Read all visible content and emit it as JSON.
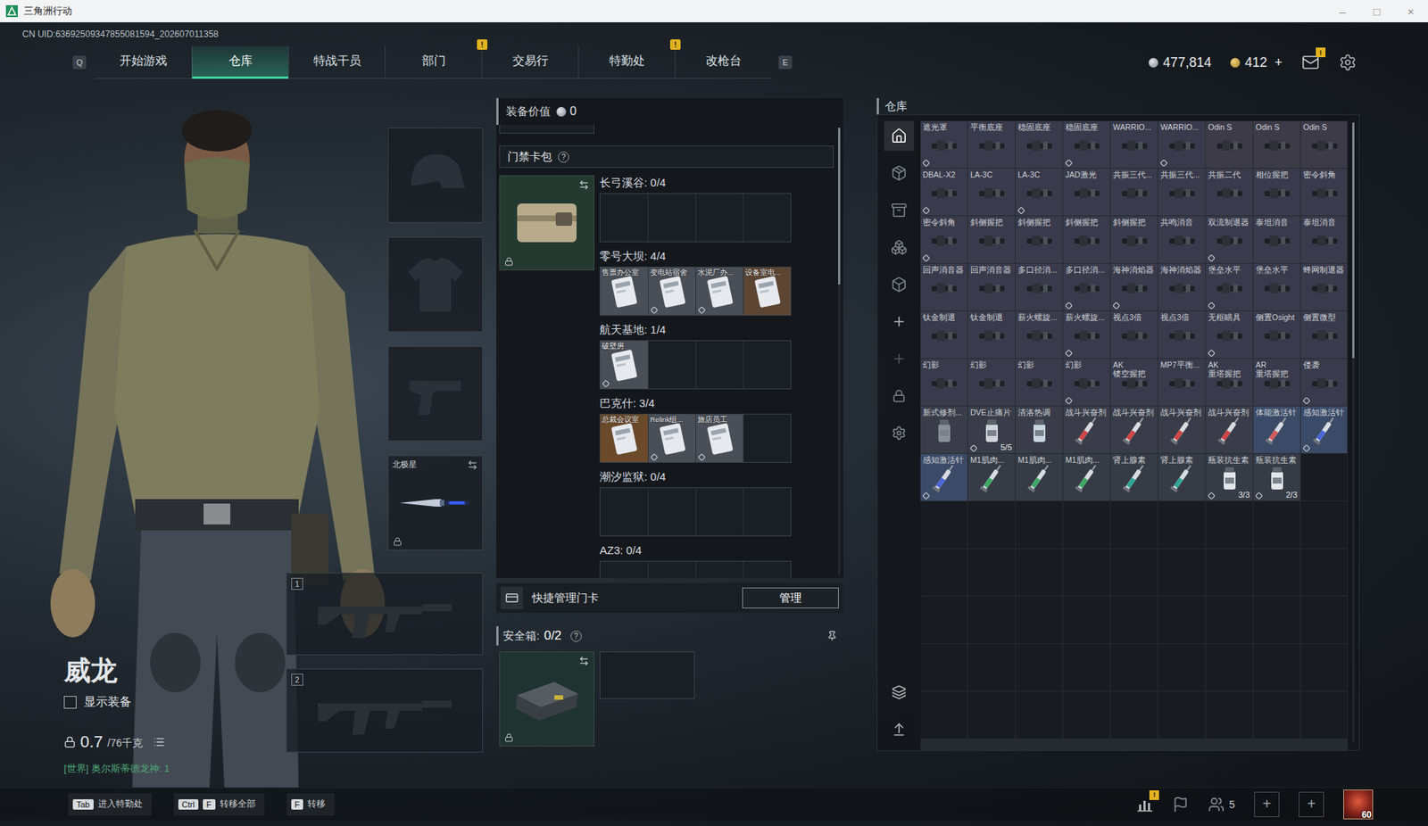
{
  "window": {
    "title": "三角洲行动",
    "controls": [
      "–",
      "□",
      "×"
    ]
  },
  "uid": "CN UID:63692509347855081594_202607011358",
  "nav": {
    "prev_key": "Q",
    "next_key": "E",
    "tabs": [
      {
        "label": "开始游戏",
        "selected": false
      },
      {
        "label": "仓库",
        "selected": true
      },
      {
        "label": "特战干员",
        "selected": false
      },
      {
        "label": "部门",
        "selected": false,
        "badge": "!"
      },
      {
        "label": "交易行",
        "selected": false
      },
      {
        "label": "特勤处",
        "selected": false,
        "badge": "!"
      },
      {
        "label": "改枪台",
        "selected": false
      }
    ]
  },
  "currency": [
    {
      "value": "477,814",
      "kind": "silver"
    },
    {
      "value": "412",
      "kind": "gold",
      "add": "+"
    }
  ],
  "mail_badge": "!",
  "character": {
    "name": "威龙",
    "show_equipment": {
      "label": "显示装备",
      "checked": false
    },
    "weight": {
      "value": "0.7",
      "capacity": "/76千克"
    },
    "world_chat": "[世界] 奥尔斯蒂德龙神: 1"
  },
  "equipment": {
    "slots": [
      {
        "kind": "helmet"
      },
      {
        "kind": "armor"
      },
      {
        "kind": "pistol"
      },
      {
        "kind": "knife",
        "label": "北极星",
        "locked": true
      }
    ],
    "weapons": [
      {
        "number": "1"
      },
      {
        "number": "2"
      }
    ]
  },
  "loadout": {
    "value_label": "装备价值",
    "value": "0",
    "keycard_pack": {
      "title": "门禁卡包",
      "help": "?",
      "locked": true,
      "scrollbar": {
        "offset": 0.0,
        "size": 0.35
      },
      "maps": [
        {
          "label": "长弓溪谷: 0/4",
          "slots": 4,
          "cards": []
        },
        {
          "label": "零号大坝: 4/4",
          "slots": 4,
          "cards": [
            {
              "label": "售票办公室",
              "color": "#4a4e57",
              "marked": false
            },
            {
              "label": "变电站宿舍",
              "color": "#4a4e57",
              "marked": true
            },
            {
              "label": "水泥厂办...",
              "color": "#4a4e57",
              "marked": true
            },
            {
              "label": "设备室电...",
              "color": "#5c4633",
              "marked": false
            }
          ]
        },
        {
          "label": "航天基地: 1/4",
          "slots": 4,
          "cards": [
            {
              "label": "破壁房",
              "color": "#4a4e57",
              "marked": true
            }
          ]
        },
        {
          "label": "巴克什: 3/4",
          "slots": 4,
          "cards": [
            {
              "label": "总裁会议室",
              "color": "#6b4a2a",
              "marked": false
            },
            {
              "label": "Relink组...",
              "color": "#4a4e57",
              "marked": true
            },
            {
              "label": "旅店员工",
              "color": "#4a4e57",
              "marked": true
            }
          ]
        },
        {
          "label": "潮汐监狱: 0/4",
          "slots": 4,
          "cards": []
        },
        {
          "label": "AZ3: 0/4",
          "slots": 4,
          "cards": []
        }
      ]
    },
    "quick_manage": {
      "label": "快捷管理门卡",
      "button": "管理"
    },
    "safebox": {
      "label": "安全箱:",
      "count": "0/2",
      "help": "?",
      "locked": true
    }
  },
  "warehouse": {
    "title": "仓库",
    "rail": [
      {
        "selected": true
      },
      {
        "selected": false
      },
      {
        "selected": false
      },
      {
        "selected": false
      },
      {
        "selected": false
      }
    ],
    "scrollbar": {
      "offset": 0.0,
      "size": 0.38
    },
    "rows": 13,
    "columns": 9,
    "items": [
      {
        "label": "遮光罩",
        "kind": "attachment",
        "color": "#393a4b",
        "marked": true
      },
      {
        "label": "平衡底座",
        "kind": "attachment",
        "color": "#393a4b",
        "marked": false
      },
      {
        "label": "稳固底座",
        "kind": "attachment",
        "color": "#393a4b",
        "marked": false
      },
      {
        "label": "稳固底座",
        "kind": "attachment",
        "color": "#393a4b",
        "marked": true
      },
      {
        "label": "WARRIO...",
        "kind": "attachment",
        "color": "#393a4b",
        "marked": false
      },
      {
        "label": "WARRIO...",
        "kind": "attachment",
        "color": "#393a4b",
        "marked": true
      },
      {
        "label": "Odin S",
        "kind": "attachment",
        "color": "#3d3b48",
        "marked": false
      },
      {
        "label": "Odin S",
        "kind": "attachment",
        "color": "#3d3b48",
        "marked": false
      },
      {
        "label": "Odin S",
        "kind": "attachment",
        "color": "#3d3b48",
        "marked": false
      },
      {
        "label": "DBAL-X2",
        "kind": "attachment",
        "color": "#393a4b",
        "marked": true
      },
      {
        "label": "LA-3C",
        "kind": "attachment",
        "color": "#393a4b",
        "marked": false
      },
      {
        "label": "LA-3C",
        "kind": "attachment",
        "color": "#393a4b",
        "marked": true
      },
      {
        "label": "JAD激光",
        "kind": "attachment",
        "color": "#393a4b",
        "marked": false
      },
      {
        "label": "共振三代...",
        "kind": "attachment",
        "color": "#393a4b",
        "marked": false
      },
      {
        "label": "共振三代...",
        "kind": "attachment",
        "color": "#393a4b",
        "marked": false
      },
      {
        "label": "共振二代",
        "kind": "attachment",
        "color": "#393a4b",
        "marked": false
      },
      {
        "label": "相位握把",
        "kind": "attachment",
        "color": "#393a4b",
        "marked": false
      },
      {
        "label": "密令斜角",
        "kind": "attachment",
        "color": "#393a4b",
        "marked": false
      },
      {
        "label": "密令斜角",
        "kind": "attachment",
        "color": "#393a4b",
        "marked": true
      },
      {
        "label": "斜侧握把",
        "kind": "attachment",
        "color": "#393a4b",
        "marked": false
      },
      {
        "label": "斜侧握把",
        "kind": "attachment",
        "color": "#393a4b",
        "marked": false
      },
      {
        "label": "斜侧握把",
        "kind": "attachment",
        "color": "#393a4b",
        "marked": false
      },
      {
        "label": "斜侧握把",
        "kind": "attachment",
        "color": "#393a4b",
        "marked": false
      },
      {
        "label": "共鸣消音",
        "kind": "attachment",
        "color": "#393a4b",
        "marked": false
      },
      {
        "label": "双流制退器",
        "kind": "attachment",
        "color": "#393a4b",
        "marked": true
      },
      {
        "label": "泰坦消音",
        "kind": "attachment",
        "color": "#393a4b",
        "marked": false
      },
      {
        "label": "泰坦消音",
        "kind": "attachment",
        "color": "#393a4b",
        "marked": false
      },
      {
        "label": "回声消音器",
        "kind": "attachment",
        "color": "#393a4b",
        "marked": false
      },
      {
        "label": "回声消音器",
        "kind": "attachment",
        "color": "#393a4b",
        "marked": false
      },
      {
        "label": "多口径消...",
        "kind": "attachment",
        "color": "#393a4b",
        "marked": false
      },
      {
        "label": "多口径消...",
        "kind": "attachment",
        "color": "#393a4b",
        "marked": true
      },
      {
        "label": "海神消焰器",
        "kind": "attachment",
        "color": "#393a4b",
        "marked": true
      },
      {
        "label": "海神消焰器",
        "kind": "attachment",
        "color": "#393a4b",
        "marked": false
      },
      {
        "label": "堡垒水平",
        "kind": "attachment",
        "color": "#393a4b",
        "marked": true
      },
      {
        "label": "堡垒水平",
        "kind": "attachment",
        "color": "#393a4b",
        "marked": false
      },
      {
        "label": "蜂网制退器",
        "kind": "attachment",
        "color": "#393a4b",
        "marked": false
      },
      {
        "label": "钛金制退",
        "kind": "attachment",
        "color": "#393a4b",
        "marked": false
      },
      {
        "label": "钛金制退",
        "kind": "attachment",
        "color": "#393a4b",
        "marked": false
      },
      {
        "label": "薪火螺旋...",
        "kind": "attachment",
        "color": "#393a4b",
        "marked": false
      },
      {
        "label": "薪火螺旋...",
        "kind": "attachment",
        "color": "#393a4b",
        "marked": true
      },
      {
        "label": "视点3倍",
        "kind": "attachment",
        "color": "#393a4b",
        "marked": false
      },
      {
        "label": "视点3倍",
        "kind": "attachment",
        "color": "#393a4b",
        "marked": false
      },
      {
        "label": "无框瞄具",
        "kind": "attachment",
        "color": "#393a4b",
        "marked": true
      },
      {
        "label": "侧置Osight",
        "kind": "attachment",
        "color": "#393a4b",
        "marked": false
      },
      {
        "label": "侧置微型",
        "kind": "attachment",
        "color": "#393a4b",
        "marked": false
      },
      {
        "label": "幻影",
        "kind": "attachment",
        "color": "#393a4b",
        "marked": false
      },
      {
        "label": "幻影",
        "kind": "attachment",
        "color": "#393a4b",
        "marked": false
      },
      {
        "label": "幻影",
        "kind": "attachment",
        "color": "#393a4b",
        "marked": false
      },
      {
        "label": "幻影",
        "kind": "attachment",
        "color": "#393a4b",
        "marked": true
      },
      {
        "label": "AK\n镂空握把",
        "kind": "attachment",
        "color": "#393a4b",
        "marked": false
      },
      {
        "label": "MP7平衡...",
        "kind": "attachment",
        "color": "#393a4b",
        "marked": false
      },
      {
        "label": "AK\n重塔握把",
        "kind": "attachment",
        "color": "#393a4b",
        "marked": false
      },
      {
        "label": "AR\n重塔握把",
        "kind": "attachment",
        "color": "#393a4b",
        "marked": false
      },
      {
        "label": "侵袭",
        "kind": "attachment",
        "color": "#393a4b",
        "marked": true
      },
      {
        "label": "新式修剂...",
        "kind": "bottle",
        "color": "#3a3d49",
        "marked": false,
        "accent": "#8a8f99"
      },
      {
        "label": "DVE止痛片",
        "kind": "bottle",
        "color": "#3a3d49",
        "marked": true,
        "count": "5/5",
        "accent": "#d0d4da"
      },
      {
        "label": "清洛热调",
        "kind": "bottle",
        "color": "#3a3d49",
        "marked": false,
        "accent": "#c9d6e0"
      },
      {
        "label": "战斗兴奋剂",
        "kind": "syringe",
        "color": "#3a3d49",
        "marked": false,
        "accent": "#d04545"
      },
      {
        "label": "战斗兴奋剂",
        "kind": "syringe",
        "color": "#3a3d49",
        "marked": false,
        "accent": "#d04545"
      },
      {
        "label": "战斗兴奋剂",
        "kind": "syringe",
        "color": "#3a3d49",
        "marked": false,
        "accent": "#d04545"
      },
      {
        "label": "战斗兴奋剂",
        "kind": "syringe",
        "color": "#3a3d49",
        "marked": false,
        "accent": "#d04545"
      },
      {
        "label": "体能激活针",
        "kind": "syringe",
        "color": "#3b4a66",
        "marked": false,
        "accent": "#d05a5a"
      },
      {
        "label": "感知激活针",
        "kind": "syringe",
        "color": "#3b4a66",
        "marked": true,
        "accent": "#4a66d8"
      },
      {
        "label": "感知激活针",
        "kind": "syringe",
        "color": "#3b4a66",
        "marked": true,
        "accent": "#4a66d8"
      },
      {
        "label": "M1肌肉...",
        "kind": "syringe",
        "color": "#363b45",
        "marked": false,
        "accent": "#3fa865"
      },
      {
        "label": "M1肌肉...",
        "kind": "syringe",
        "color": "#363b45",
        "marked": false,
        "accent": "#3fa865"
      },
      {
        "label": "M1肌肉...",
        "kind": "syringe",
        "color": "#363b45",
        "marked": false,
        "accent": "#3fa865"
      },
      {
        "label": "肾上腺素",
        "kind": "syringe",
        "color": "#363b45",
        "marked": false,
        "accent": "#2fa596"
      },
      {
        "label": "肾上腺素",
        "kind": "syringe",
        "color": "#363b45",
        "marked": false,
        "accent": "#2fa596"
      },
      {
        "label": "瓶装抗生素",
        "kind": "bottle",
        "color": "#363b45",
        "marked": true,
        "count": "3/3",
        "accent": "#e2e6ea"
      },
      {
        "label": "瓶装抗生素",
        "kind": "bottle",
        "color": "#363b45",
        "marked": true,
        "count": "2/3",
        "accent": "#e2e6ea"
      }
    ]
  },
  "bottom_bar": {
    "hints": [
      {
        "keys": [
          "Tab"
        ],
        "label": "进入特勤处"
      },
      {
        "keys": [
          "Ctrl",
          "F"
        ],
        "label": "转移全部"
      },
      {
        "keys": [
          "F"
        ],
        "label": "转移"
      }
    ],
    "stats_badge": "!",
    "friends": "5",
    "add_slots": [
      "+",
      "+"
    ],
    "level": "60"
  }
}
